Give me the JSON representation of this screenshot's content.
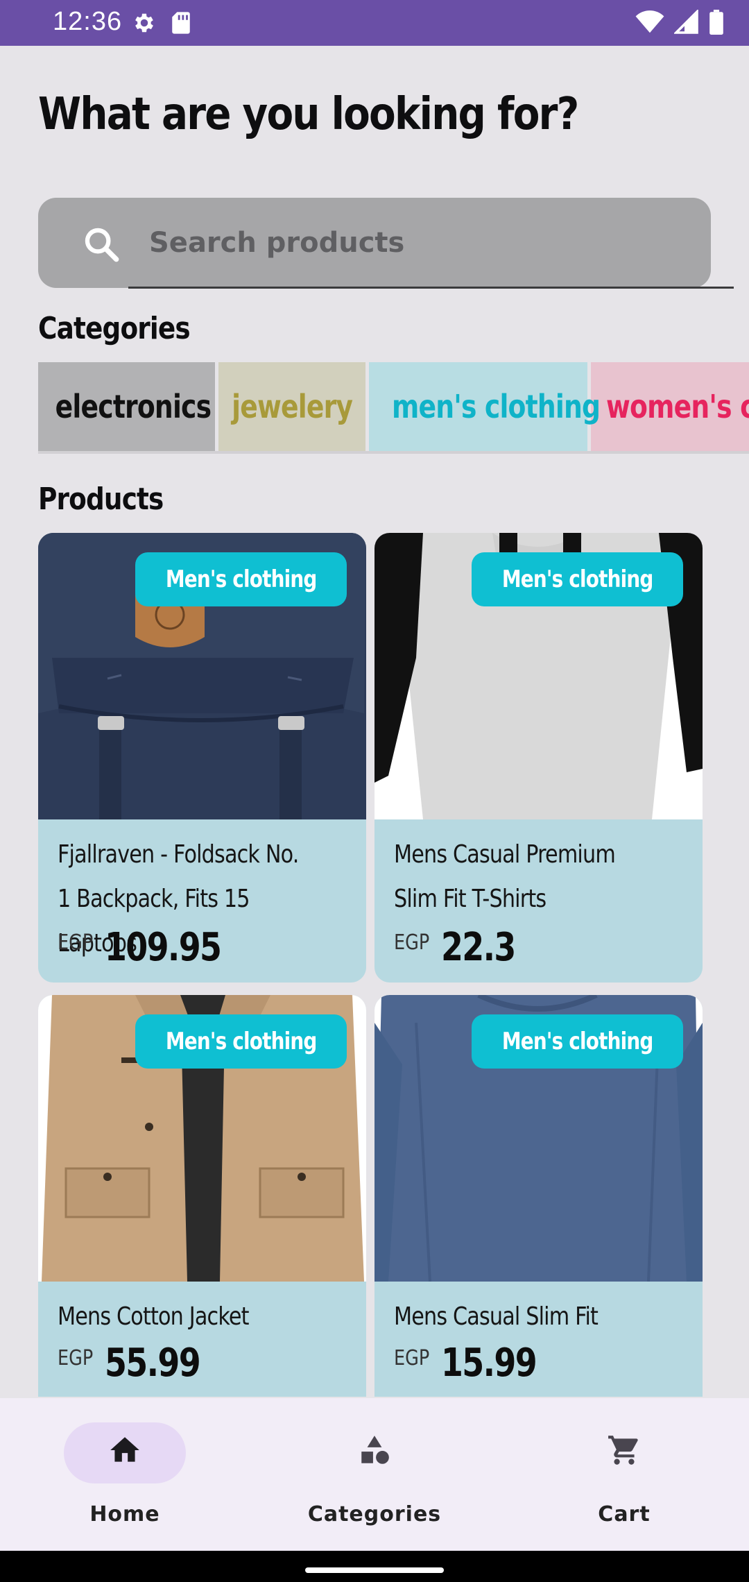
{
  "status_bar": {
    "time": "12:36",
    "left_icons": [
      "gear-icon",
      "sd-card-icon"
    ],
    "right_icons": [
      "wifi-icon",
      "signal-icon",
      "battery-icon"
    ]
  },
  "page": {
    "title": "What are you looking for?"
  },
  "search": {
    "placeholder": "Search products",
    "value": "",
    "icon": "search-icon"
  },
  "categories": {
    "title": "Categories",
    "items": [
      {
        "label": "electronics",
        "bg": "#b2b2b4",
        "fg": "#111111"
      },
      {
        "label": "jewelery",
        "bg": "#d2d0bd",
        "fg": "#a89a3a"
      },
      {
        "label": "men's clothing",
        "bg": "#b8dde3",
        "fg": "#0fb3c8"
      },
      {
        "label": "women's clothing",
        "bg": "#e8c3cf",
        "fg": "#e6245e"
      }
    ]
  },
  "products": {
    "title": "Products",
    "items": [
      {
        "badge": "Men's clothing",
        "name": "Fjallraven - Foldsack No. 1 Backpack, Fits 15 Laptops",
        "currency": "EGP",
        "price": "109.95",
        "image": "backpack"
      },
      {
        "badge": "Men's clothing",
        "name": "Mens Casual Premium Slim Fit T-Shirts",
        "currency": "EGP",
        "price": "22.3",
        "image": "tshirt"
      },
      {
        "badge": "Men's clothing",
        "name": "Mens Cotton Jacket",
        "currency": "EGP",
        "price": "55.99",
        "image": "jacket"
      },
      {
        "badge": "Men's clothing",
        "name": "Mens Casual Slim Fit",
        "currency": "EGP",
        "price": "15.99",
        "image": "longsleeve"
      }
    ]
  },
  "bottom_nav": {
    "items": [
      {
        "label": "Home",
        "icon": "home-icon",
        "active": true
      },
      {
        "label": "Categories",
        "icon": "shapes-icon",
        "active": false
      },
      {
        "label": "Cart",
        "icon": "cart-icon",
        "active": false
      }
    ]
  },
  "colors": {
    "status_bar": "#6a4fa6",
    "badge": "#0fbfd2",
    "card": "#b7d9e1",
    "nav_active_pill": "#e6d9f5"
  }
}
